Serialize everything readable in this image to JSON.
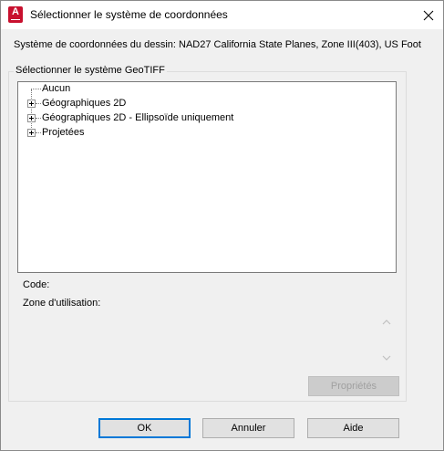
{
  "window": {
    "title": "Sélectionner le système de coordonnées",
    "app_icon_letter": "A"
  },
  "drawing_cs": {
    "label": "Système de coordonnées du dessin:",
    "value": "NAD27 California State Planes, Zone III(403), US Foot"
  },
  "geotiff_group": {
    "title": "Sélectionner le système GeoTIFF",
    "tree_items": [
      {
        "label": "Aucun",
        "expandable": false
      },
      {
        "label": "Géographiques 2D",
        "expandable": true
      },
      {
        "label": "Géographiques 2D - Ellipsoïde uniquement",
        "expandable": true
      },
      {
        "label": "Projetées",
        "expandable": true
      }
    ],
    "code_label": "Code:",
    "zone_label": "Zone d'utilisation:",
    "properties_button": "Propriétés"
  },
  "footer": {
    "ok": "OK",
    "cancel": "Annuler",
    "help": "Aide"
  },
  "colors": {
    "accent": "#0078d7",
    "app_icon": "#c8102e"
  }
}
